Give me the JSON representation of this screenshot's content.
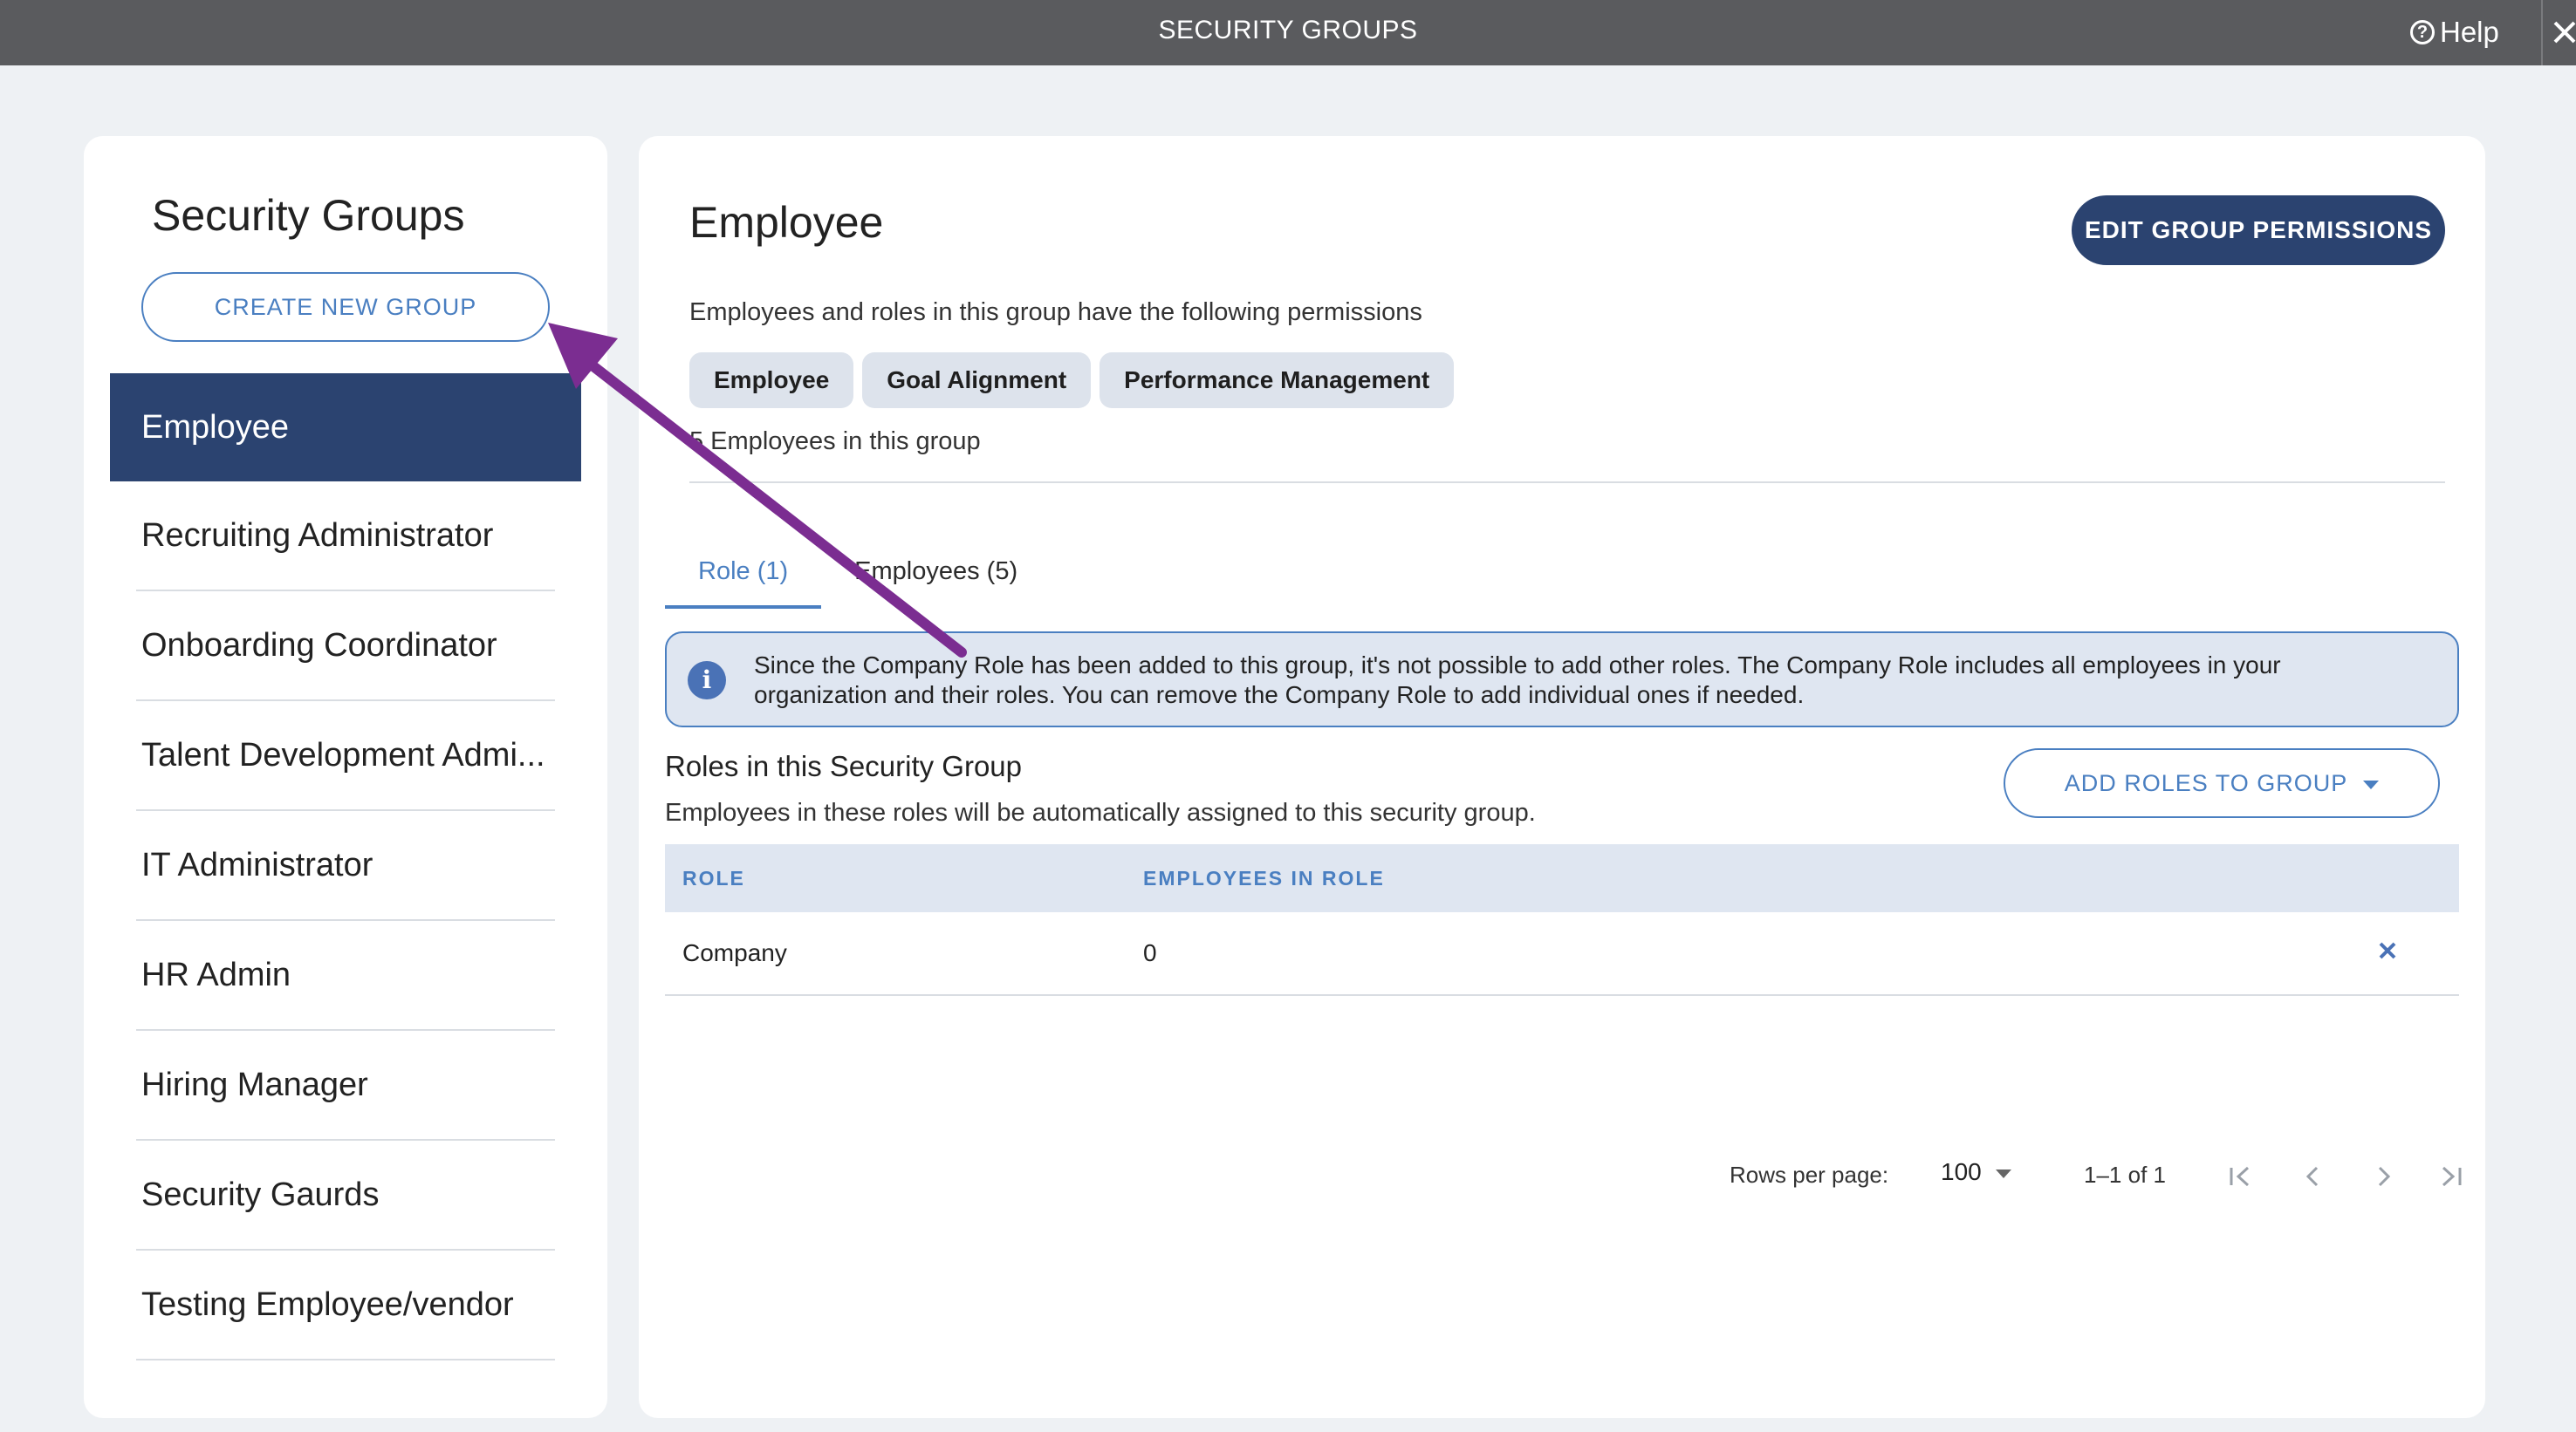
{
  "topbar": {
    "title": "SECURITY GROUPS",
    "help_label": "Help"
  },
  "sidebar": {
    "heading": "Security Groups",
    "create_label": "CREATE NEW GROUP",
    "items": [
      {
        "label": "Employee",
        "active": true
      },
      {
        "label": "Recruiting Administrator"
      },
      {
        "label": "Onboarding Coordinator"
      },
      {
        "label": "Talent Development Admi..."
      },
      {
        "label": "IT Administrator"
      },
      {
        "label": "HR Admin"
      },
      {
        "label": "Hiring Manager"
      },
      {
        "label": "Security Gaurds"
      },
      {
        "label": "Testing Employee/vendor"
      }
    ]
  },
  "main": {
    "title": "Employee",
    "edit_label": "EDIT GROUP PERMISSIONS",
    "description": "Employees and roles in this group have the following permissions",
    "permissions": [
      "Employee",
      "Goal Alignment",
      "Performance Management"
    ],
    "employee_count_text": "5 Employees in this group",
    "tabs": [
      {
        "label": "Role (1)",
        "active": true
      },
      {
        "label": "Employees (5)"
      }
    ],
    "info_text": "Since the Company Role has been added to this group, it's not possible to add other roles. The Company Role includes all employees in your organization and their roles. You can remove the Company Role to add individual ones if needed.",
    "roles_title": "Roles in this Security Group",
    "roles_subtitle": "Employees in these roles will be automatically assigned to this security group.",
    "add_roles_label": "ADD ROLES TO GROUP",
    "table": {
      "columns": [
        "ROLE",
        "EMPLOYEES IN ROLE"
      ],
      "rows": [
        {
          "role": "Company",
          "employees": "0"
        }
      ]
    },
    "pagination": {
      "rows_per_page_label": "Rows per page:",
      "rows_per_page": "100",
      "range": "1–1 of 1"
    }
  },
  "colors": {
    "topbar": "#5a5b5e",
    "accent": "#4a7fc1",
    "navy": "#2b4370",
    "annotation_arrow": "#7b2d91"
  },
  "icons": [
    "help-icon",
    "close-icon",
    "info-icon",
    "remove-icon",
    "first-page-icon",
    "prev-page-icon",
    "next-page-icon",
    "last-page-icon",
    "dropdown-caret-icon"
  ]
}
